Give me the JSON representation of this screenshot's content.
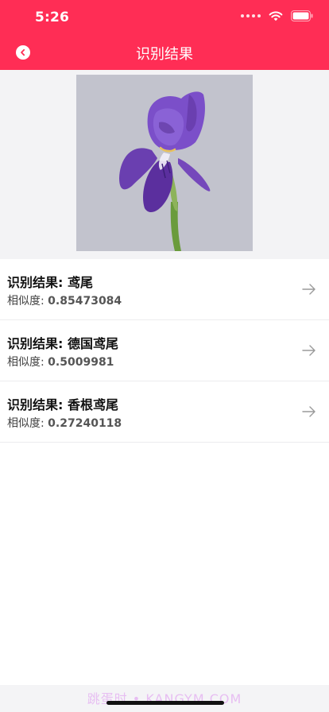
{
  "status_bar": {
    "time": "5:26"
  },
  "header": {
    "title": "识别结果",
    "back_icon": "back-circle-icon",
    "background_color": "#ff2d55"
  },
  "results": [
    {
      "title": "识别结果: 鸢尾",
      "similarity_label": "相似度: ",
      "similarity_value": "0.85473084"
    },
    {
      "title": "识别结果: 德国鸢尾",
      "similarity_label": "相似度: ",
      "similarity_value": "0.5009981"
    },
    {
      "title": "识别结果: 香根鸢尾",
      "similarity_label": "相似度: ",
      "similarity_value": "0.27240118"
    }
  ],
  "watermark": "跳蛋时 • KANGYM.COM"
}
